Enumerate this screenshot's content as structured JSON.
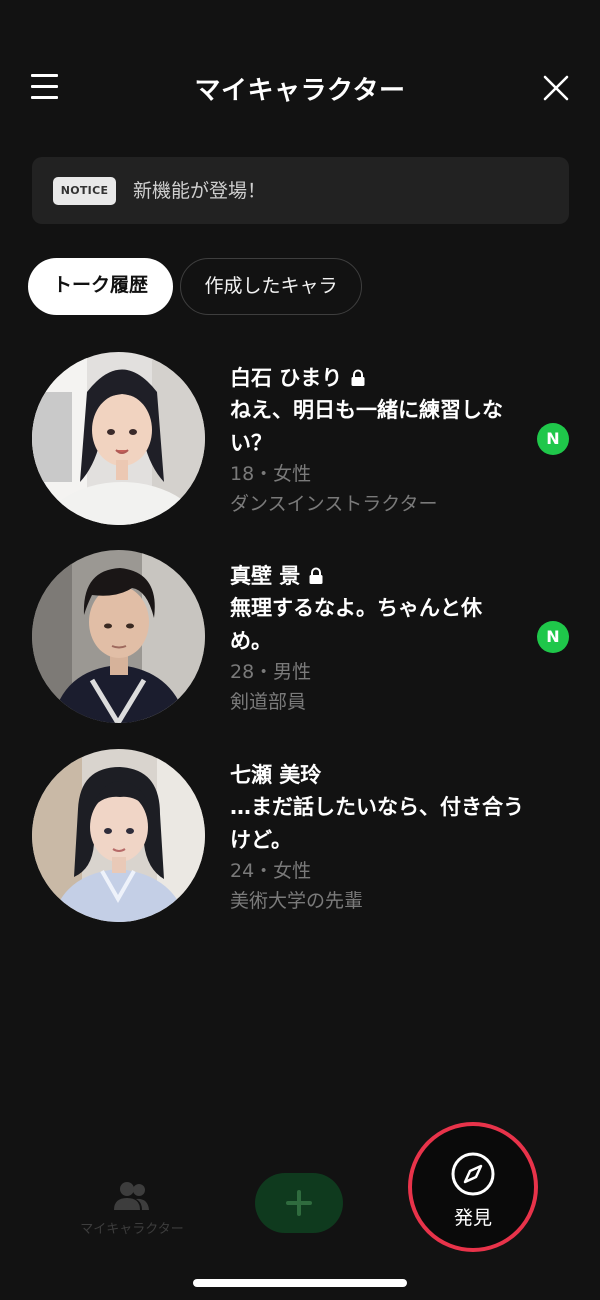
{
  "header": {
    "title": "マイキャラクター"
  },
  "notice": {
    "badge": "NOTICE",
    "text": "新機能が登場！"
  },
  "tabs": [
    {
      "label": "トーク履歴",
      "active": true
    },
    {
      "label": "作成したキャラ",
      "active": false
    }
  ],
  "characters": [
    {
      "name": "白石 ひまり",
      "locked": true,
      "message_lines": [
        "ねえ、明日も一緒に練習しな",
        "い？"
      ],
      "age_gender": "18・女性",
      "role": "ダンスインストラクター",
      "badge": "N"
    },
    {
      "name": "真壁 景",
      "locked": true,
      "message_lines": [
        "無理するなよ。ちゃんと休",
        "め。"
      ],
      "age_gender": "28・男性",
      "role": "剣道部員",
      "badge": "N"
    },
    {
      "name": "七瀬 美玲",
      "locked": false,
      "message_lines": [
        "…まだ話したいなら、付き合う",
        "けど。"
      ],
      "age_gender": "24・女性",
      "role": "美術大学の先輩",
      "badge": ""
    }
  ],
  "bottom_nav": {
    "my_characters_label": "マイキャラクター",
    "add_label": "+",
    "discover_label": "発見"
  },
  "colors": {
    "background": "#121212",
    "new_badge": "#1fc74a",
    "discover_ring": "#e8334a",
    "add_button": "#0f3a1e"
  }
}
